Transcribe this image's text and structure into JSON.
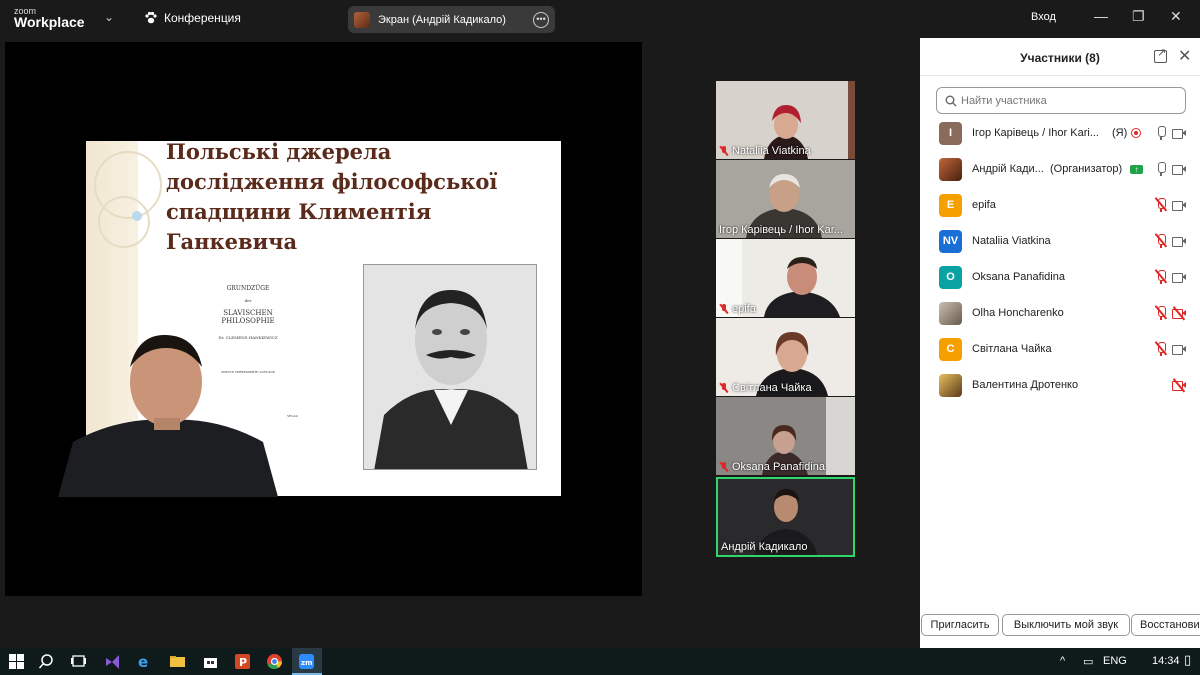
{
  "app": {
    "logo_top": "zoom",
    "logo_bottom": "Workplace",
    "meeting_menu": "Конференция",
    "screen_share_label": "Экран (Андрій Кадикало)",
    "signin": "Вход"
  },
  "slide": {
    "title": "Польські джерела дослідження філософської спадщини Климентія Ганкевича",
    "book": {
      "line1": "GRUNDZÜGE",
      "line2": "der",
      "line3": "SLAVISCHEN PHILOSOPHIE",
      "line4": "Dr. CLEMENS HANKIEWICZ",
      "line5": "ZWEITE VERBESSERTE AUFLAGE",
      "line6": "VELAG"
    }
  },
  "video_tiles": [
    {
      "name": "Nataliia Viatkina",
      "muted": true
    },
    {
      "name": "Ігор Карівець / Ihor Kar...",
      "muted": false
    },
    {
      "name": "epifa",
      "muted": true
    },
    {
      "name": "Світлана Чайка",
      "muted": true
    },
    {
      "name": "Oksana Panafidina",
      "muted": true
    },
    {
      "name": "Андрій Кадикало",
      "muted": false
    }
  ],
  "participants_panel": {
    "title": "Участники (8)",
    "search_placeholder": "Найти участника",
    "participants": [
      {
        "name": "Ігор Карівець / Ihor Kari...",
        "role": "(Я)",
        "avatar_text": "I",
        "avatar_color": "#8a6a5a",
        "mic": "on",
        "cam": "on",
        "recording": true
      },
      {
        "name": "Андрій Кади...",
        "role": "(Организатор)",
        "avatar_text": "",
        "avatar_color": "#8a4a2a",
        "mic": "on",
        "cam": "on",
        "sharing": true
      },
      {
        "name": "epifa",
        "avatar_text": "E",
        "avatar_color": "#f5a000",
        "mic": "off",
        "cam": "on"
      },
      {
        "name": "Nataliia Viatkina",
        "avatar_text": "NV",
        "avatar_color": "#1a6fd6",
        "mic": "off",
        "cam": "on"
      },
      {
        "name": "Oksana Panafidina",
        "avatar_text": "O",
        "avatar_color": "#0aa2a2",
        "mic": "off",
        "cam": "on"
      },
      {
        "name": "Olha Honcharenko",
        "avatar_text": "",
        "avatar_color": "#9a8a7a",
        "mic": "off",
        "cam": "off"
      },
      {
        "name": "Світлана Чайка",
        "avatar_text": "C",
        "avatar_color": "#f5a000",
        "mic": "off",
        "cam": "on"
      },
      {
        "name": "Валентина Дротенко",
        "avatar_text": "",
        "avatar_color": "#7a5a2a",
        "mic": "none",
        "cam": "off"
      }
    ],
    "buttons": {
      "invite": "Пригласить",
      "mute_me": "Выключить мой звук",
      "restore": "Восстанови"
    }
  },
  "taskbar": {
    "language": "ENG",
    "time": "14:34"
  }
}
